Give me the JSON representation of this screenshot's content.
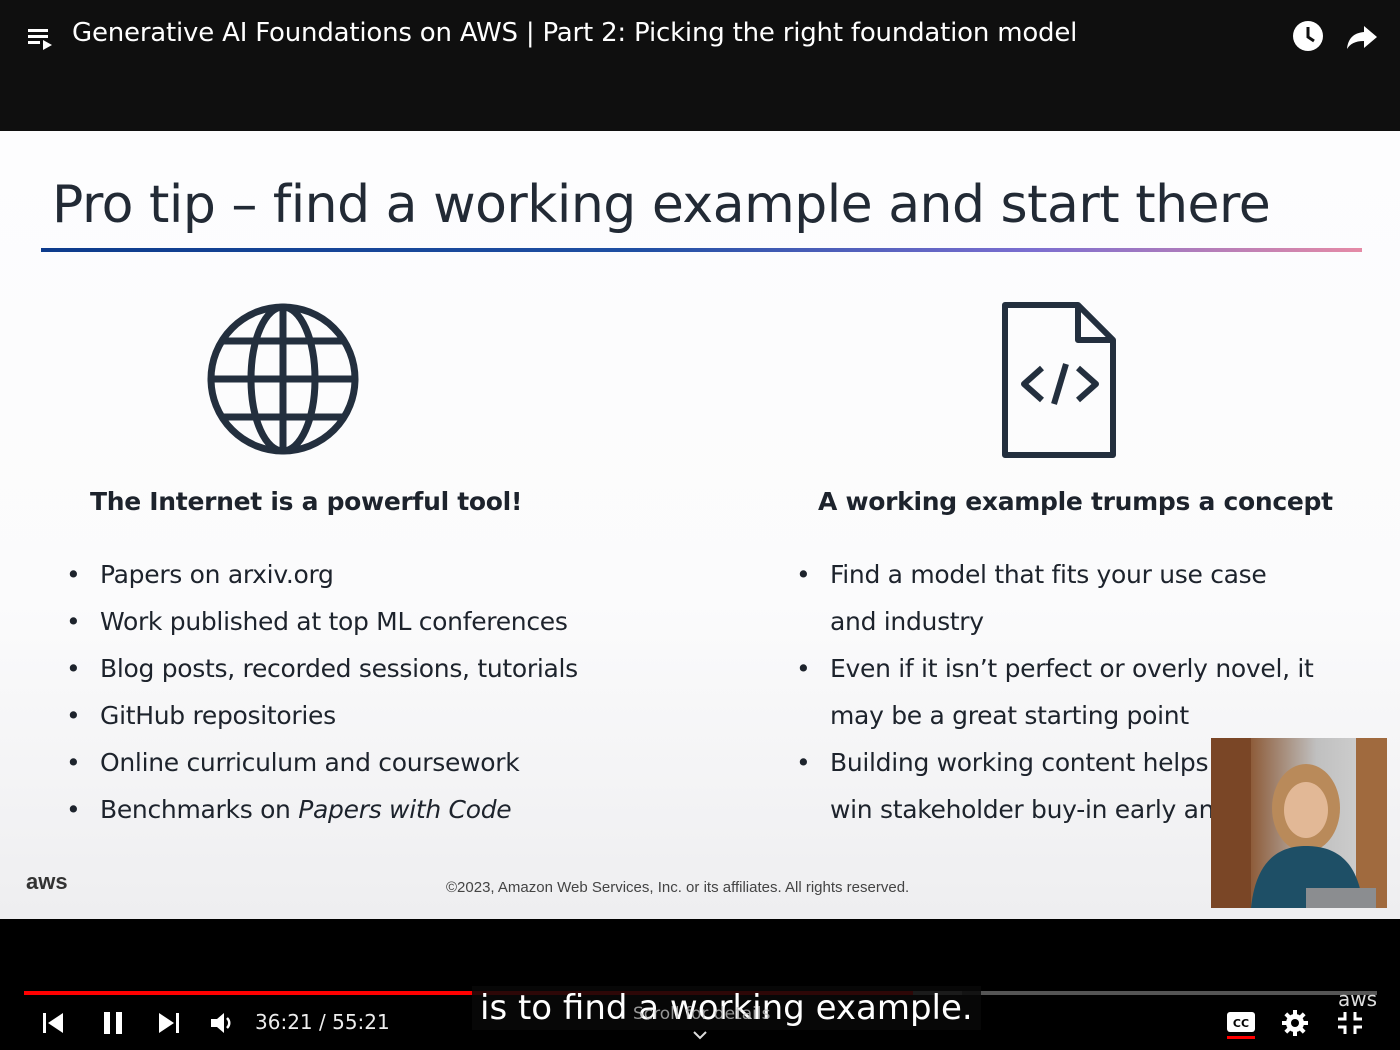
{
  "player": {
    "title": "Generative AI Foundations on AWS | Part 2: Picking the right foundation model"
  },
  "slide": {
    "title": "Pro tip – find a working example and start there",
    "left_heading": "The Internet is a powerful tool!",
    "left_bullets": [
      "Papers on arxiv.org",
      "Work published at top ML conferences",
      "Blog posts, recorded sessions, tutorials",
      "GitHub repositories",
      "Online curriculum and coursework",
      "Benchmarks on "
    ],
    "left_bullet_italic": "Papers with Code",
    "right_heading": "A working example trumps a concept",
    "right_lines": [
      "Find a model that fits your use case",
      "and industry",
      "Even if it isn’t perfect or overly novel, it",
      "may be a great starting point",
      "Building working content helps",
      "win stakeholder buy-in early and"
    ],
    "aws_logo": "aws",
    "copyright": "©2023, Amazon Web Services, Inc. or its affiliates. All rights reserved."
  },
  "controls": {
    "time": "36:21 / 55:21",
    "caption": "is to find a working example.",
    "scroll_hint": "Scroll for details",
    "aws_corner": "aws",
    "progress_fraction": 0.657
  },
  "icons": [
    "playlist-icon",
    "watch-later-icon",
    "share-icon",
    "globe-icon",
    "code-file-icon",
    "previous-icon",
    "pause-icon",
    "next-icon",
    "volume-icon",
    "cc-icon",
    "settings-icon",
    "exit-fullscreen-icon",
    "chevron-down-icon"
  ]
}
